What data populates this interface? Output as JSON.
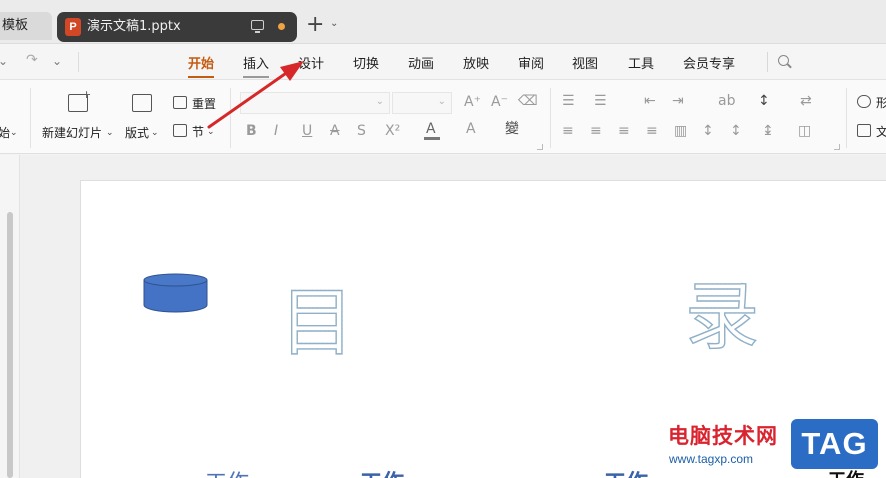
{
  "tabs": {
    "previous_label": "模板",
    "active_file": "演示文稿1.pptx",
    "ppt_icon_letter": "P",
    "new_tab_symbol": "+",
    "dropdown_symbol": "⌄"
  },
  "quick_access": {
    "undo_icon": "↶",
    "redo_icon": "↷",
    "more_icon": "⌄"
  },
  "menu": {
    "items": [
      "开始",
      "插入",
      "设计",
      "切换",
      "动画",
      "放映",
      "审阅",
      "视图",
      "工具",
      "会员专享"
    ],
    "active": "开始"
  },
  "ribbon": {
    "partial_left_label": "始",
    "new_slide_label": "新建幻灯片",
    "layout_label": "版式",
    "reset_label": "重置",
    "section_label": "节",
    "font_icons": [
      "B",
      "I",
      "U",
      "A",
      "S",
      "X²",
      "A",
      "A",
      "變"
    ],
    "size_icons": [
      "A⁺",
      "A⁻"
    ],
    "shape_label_partial": "形",
    "textbox_label_partial": "文"
  },
  "slide": {
    "title_chars": [
      "目",
      "录"
    ],
    "bottom_words": [
      "工作",
      "工作",
      "工作",
      "工作"
    ],
    "shape_color": "#4472c4"
  },
  "watermark": {
    "title": "电脑技术网",
    "url": "www.tagxp.com",
    "logo": "TAG"
  },
  "colors": {
    "active_menu": "#c55a11",
    "arrow": "#d62828",
    "tab_dark": "#3a3a3a"
  }
}
